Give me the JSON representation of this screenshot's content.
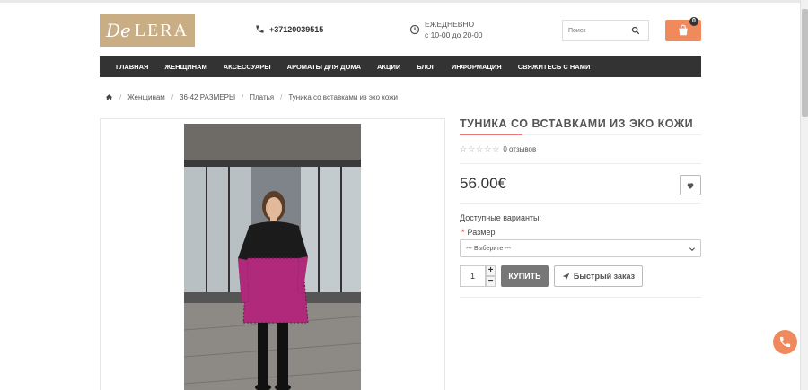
{
  "header": {
    "logo_script": "De",
    "logo_text": "LERA",
    "phone": "+37120039515",
    "hours_line1": "ЕЖЕДНЕВНО",
    "hours_line2": "с 10-00 до 20-00",
    "search_placeholder": "Поиск",
    "cart_count": "0"
  },
  "nav": {
    "items": [
      "ГЛАВНАЯ",
      "ЖЕНЩИНАМ",
      "АКСЕССУАРЫ",
      "АРОМАТЫ ДЛЯ ДОМА",
      "АКЦИИ",
      "БЛОГ",
      "ИНФОРМАЦИЯ",
      "СВЯЖИТЕСЬ С НАМИ"
    ]
  },
  "breadcrumb": [
    "Женщинам",
    "36-42 РАЗМЕРЫ",
    "Платья",
    "Туника со вставками из эко кожи"
  ],
  "product": {
    "title": "ТУНИКА СО ВСТАВКАМИ ИЗ ЭКО КОЖИ",
    "rating_stars": "☆☆☆☆☆",
    "reviews": "0 отзывов",
    "price": "56.00€",
    "options_label": "Доступные варианты:",
    "size_required": "*",
    "size_label": "Размер",
    "size_select": "--- Выберите ---",
    "quantity": "1",
    "qty_plus": "+",
    "qty_minus": "−",
    "buy_label": "КУПИТЬ",
    "quick_order_label": "Быстрый заказ"
  },
  "colors": {
    "accent": "#f08a5d",
    "nav_bg": "#333333",
    "logo_bg": "#c9ad84",
    "title_underline": "#e67a7a"
  },
  "icons": [
    "phone-icon",
    "clock-icon",
    "search-icon",
    "cart-icon",
    "home-icon",
    "heart-icon",
    "paper-plane-icon",
    "call-icon"
  ]
}
